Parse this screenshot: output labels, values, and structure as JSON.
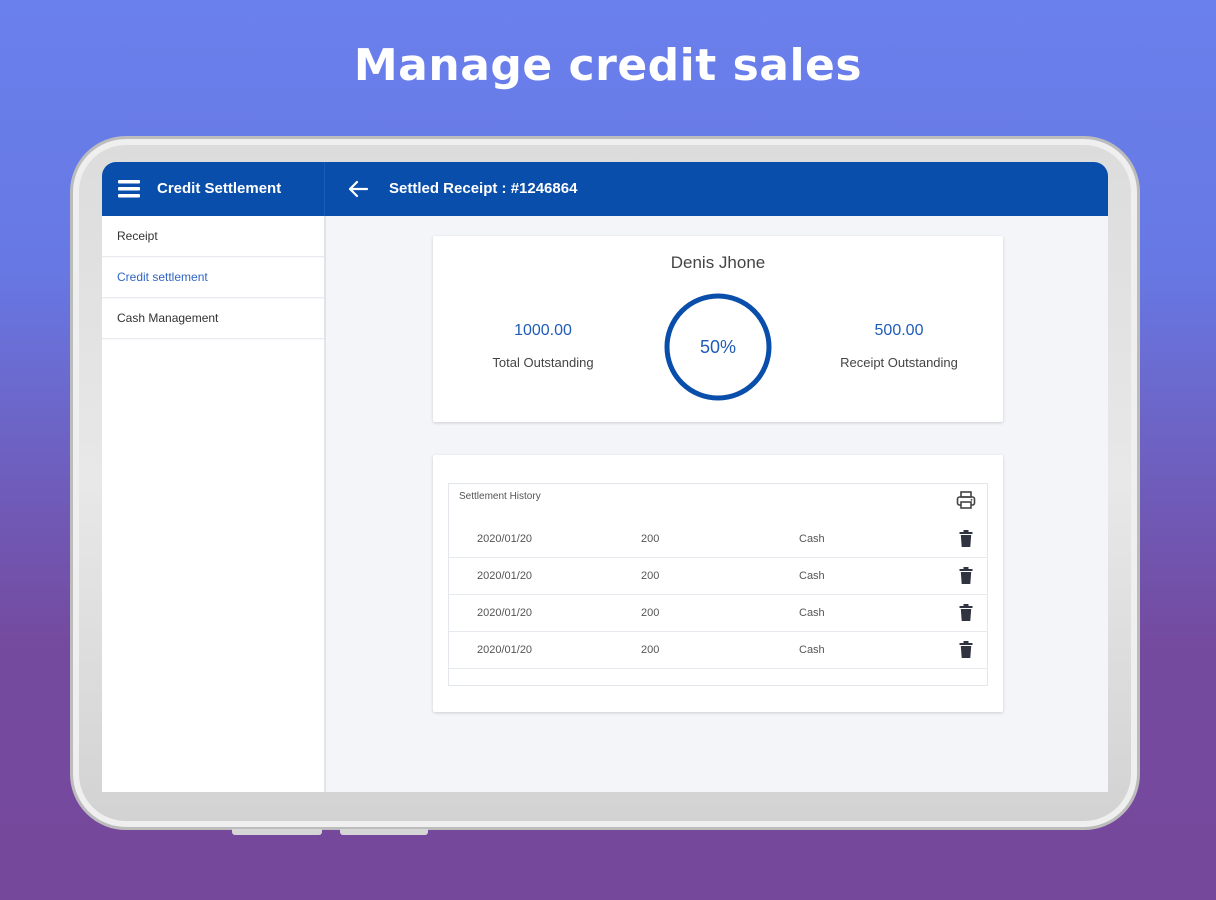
{
  "promo": {
    "headline": "Manage credit sales"
  },
  "colors": {
    "primary": "#0a4eab",
    "accent_text": "#1f5cb8",
    "background_top": "#6a80ec",
    "background_bottom": "#76489c"
  },
  "header": {
    "app_title": "Credit Settlement",
    "page_title": "Settled Receipt : #1246864",
    "menu_icon": "hamburger-menu-icon",
    "back_icon": "arrow-left-icon"
  },
  "sidebar": {
    "items": [
      {
        "label": "Receipt",
        "active": false
      },
      {
        "label": "Credit settlement",
        "active": true
      },
      {
        "label": "Cash Management",
        "active": false
      }
    ]
  },
  "summary": {
    "customer_name": "Denis Jhone",
    "total_outstanding_value": "1000.00",
    "total_outstanding_label": "Total Outstanding",
    "progress_text": "50%",
    "progress_fraction": 0.5,
    "receipt_outstanding_value": "500.00",
    "receipt_outstanding_label": "Receipt Outstanding"
  },
  "history": {
    "title": "Settlement History",
    "print_icon": "printer-icon",
    "delete_icon": "trash-icon",
    "rows": [
      {
        "date": "2020/01/20",
        "amount": "200",
        "method": "Cash"
      },
      {
        "date": "2020/01/20",
        "amount": "200",
        "method": "Cash"
      },
      {
        "date": "2020/01/20",
        "amount": "200",
        "method": "Cash"
      },
      {
        "date": "2020/01/20",
        "amount": "200",
        "method": "Cash"
      }
    ]
  }
}
